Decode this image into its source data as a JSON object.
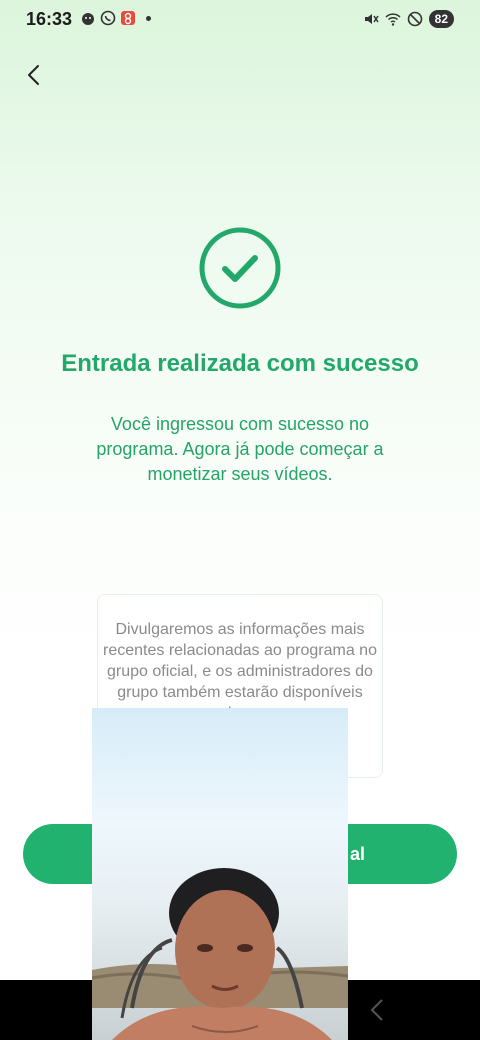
{
  "status_bar": {
    "time": "16:33",
    "battery": "82",
    "icons": [
      "android-icon",
      "whatsapp-icon",
      "app-badge-icon",
      "mute-icon",
      "wifi-icon",
      "dnd-icon"
    ]
  },
  "nav": {
    "back_icon": "chevron-left-icon"
  },
  "success": {
    "icon": "check-circle-icon",
    "title": "Entrada realizada com sucesso",
    "description": "Você ingressou com sucesso no programa. Agora já pode começar a monetizar seus vídeos."
  },
  "info_card": {
    "text": "Divulgaremos as informações mais recentes relacionadas ao programa no grupo oficial, e os administradores do grupo também estarão disponíveis para esclarecer para"
  },
  "cta": {
    "label_visible": "al"
  },
  "camera_overlay": {
    "icon": "front-camera-video-feed"
  },
  "colors": {
    "accent": "#22b26f",
    "title": "#22a86a",
    "text_muted": "#8a8a8a"
  }
}
